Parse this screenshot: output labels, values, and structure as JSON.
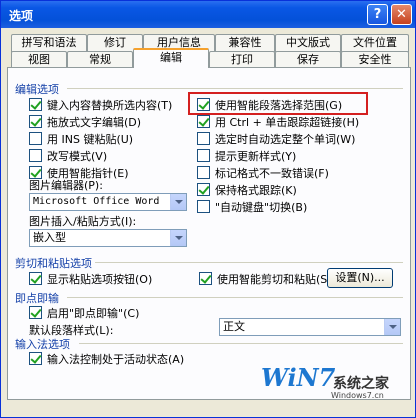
{
  "window": {
    "title": "选项",
    "help": "?",
    "close": "✕"
  },
  "tabs_row1": [
    "拼写和语法",
    "修订",
    "用户信息",
    "兼容性",
    "中文版式",
    "文件位置"
  ],
  "tabs_row2": [
    "视图",
    "常规",
    "编辑",
    "打印",
    "保存",
    "安全性"
  ],
  "active_tab": "编辑",
  "edit_options": {
    "heading": "编辑选项",
    "left": [
      {
        "label": "键入内容替换所选内容(T)",
        "checked": true
      },
      {
        "label": "拖放式文字编辑(D)",
        "checked": true
      },
      {
        "label": "用 INS 键粘贴(U)",
        "checked": false
      },
      {
        "label": "改写模式(V)",
        "checked": false
      },
      {
        "label": "使用智能指针(E)",
        "checked": true
      }
    ],
    "right": [
      {
        "label": "使用智能段落选择范围(G)",
        "checked": true
      },
      {
        "label": "用 Ctrl + 单击跟踪超链接(H)",
        "checked": true
      },
      {
        "label": "选定时自动选定整个单词(W)",
        "checked": false
      },
      {
        "label": "提示更新样式(Y)",
        "checked": false
      },
      {
        "label": "标记格式不一致错误(F)",
        "checked": false
      },
      {
        "label": "保持格式跟踪(K)",
        "checked": true
      },
      {
        "label": "\"自动键盘\"切换(B)",
        "checked": false
      }
    ],
    "picture_editor_label": "图片编辑器(P):",
    "picture_editor_value": "Microsoft Office Word",
    "insert_paste_label": "图片插入/粘贴方式(I):",
    "insert_paste_value": "嵌入型"
  },
  "cut_paste": {
    "heading": "剪切和粘贴选项",
    "show_paste_buttons": {
      "label": "显示粘贴选项按钮(O)",
      "checked": true
    },
    "smart_cut": {
      "label": "使用智能剪切和粘贴(S)",
      "checked": true
    },
    "settings_button": "设置(N)..."
  },
  "click_type": {
    "heading": "即点即输",
    "enable": {
      "label": "启用\"即点即输\"(C)",
      "checked": true
    },
    "default_style_label": "默认段落样式(L):",
    "default_style_value": "正文"
  },
  "ime": {
    "heading": "输入法选项",
    "ime_active": {
      "label": "输入法控制处于活动状态(A)",
      "checked": true
    }
  },
  "watermark": {
    "brand": "WiN7",
    "site_cn": "系统之家",
    "url": "Windows7.cn"
  }
}
